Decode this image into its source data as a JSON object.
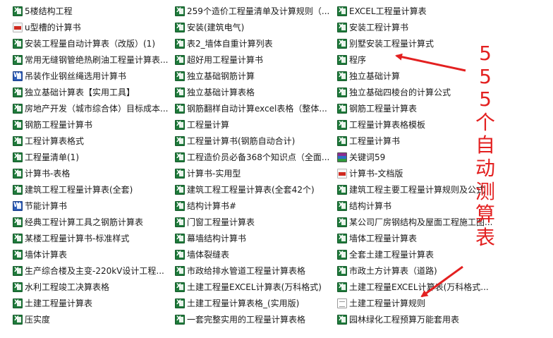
{
  "columns": [
    [
      {
        "type": "xls",
        "name": "5楼结构工程"
      },
      {
        "type": "pdf",
        "name": "u型槽的计算书"
      },
      {
        "type": "xls",
        "name": "安装工程量自动计算表（改版）(1)"
      },
      {
        "type": "xls",
        "name": "常用无缝钢管绝热刷油工程量计算表..."
      },
      {
        "type": "doc",
        "name": "吊装作业钢丝绳选用计算书"
      },
      {
        "type": "xls",
        "name": "独立基础计算表【实用工具】"
      },
      {
        "type": "xls",
        "name": "房地产开发（城市综合体）目标成本..."
      },
      {
        "type": "xls",
        "name": "钢筋工程量计算书"
      },
      {
        "type": "xls",
        "name": "工程计算表格式"
      },
      {
        "type": "xls",
        "name": "工程量清单(1)"
      },
      {
        "type": "xls",
        "name": "计算书-表格"
      },
      {
        "type": "xls",
        "name": "建筑工程工程量计算表(全套)"
      },
      {
        "type": "doc",
        "name": "节能计算书"
      },
      {
        "type": "xls",
        "name": "经典工程计算工具之钢筋计算表"
      },
      {
        "type": "xls",
        "name": "某楼工程量计算书-标准样式"
      },
      {
        "type": "xls",
        "name": "墙体计算表"
      },
      {
        "type": "xls",
        "name": "生产综合楼及主变-220kV设计工程..."
      },
      {
        "type": "xls",
        "name": "水利工程竣工决算表格"
      },
      {
        "type": "xls",
        "name": "土建工程量计算表"
      },
      {
        "type": "xls",
        "name": "压实度"
      }
    ],
    [
      {
        "type": "xls",
        "name": "259个造价工程量清单及计算规则（..."
      },
      {
        "type": "xls",
        "name": "安装(建筑电气)"
      },
      {
        "type": "xls",
        "name": "表2_墙体自重计算列表"
      },
      {
        "type": "xls",
        "name": "超好用工程量计算书"
      },
      {
        "type": "xls",
        "name": "独立基础钢筋计算"
      },
      {
        "type": "xls",
        "name": "独立基础计算表格"
      },
      {
        "type": "xls",
        "name": "钢筋翻样自动计算excel表格（整体..."
      },
      {
        "type": "xls",
        "name": "工程量计算"
      },
      {
        "type": "xls",
        "name": "工程量计算书(钢筋自动合计)"
      },
      {
        "type": "xls",
        "name": "工程造价员必备368个知识点（全面..."
      },
      {
        "type": "xls",
        "name": "计算书-实用型"
      },
      {
        "type": "xls",
        "name": "建筑工程工程量计算表(全套42个)"
      },
      {
        "type": "xls",
        "name": "结构计算书#"
      },
      {
        "type": "xls",
        "name": "门窗工程量计算表"
      },
      {
        "type": "xls",
        "name": "幕墙结构计算书"
      },
      {
        "type": "xls",
        "name": "墙体裂缝表"
      },
      {
        "type": "xls",
        "name": "市政给排水管道工程量计算表格"
      },
      {
        "type": "xls",
        "name": "土建工程量EXCEL计算表(万科格式)"
      },
      {
        "type": "xls",
        "name": "土建工程量计算表格_(实用版)"
      },
      {
        "type": "xls",
        "name": "一套完整实用的工程量计算表格"
      }
    ],
    [
      {
        "type": "xls",
        "name": "EXCEL工程量计算表"
      },
      {
        "type": "xls",
        "name": "安装工程计算书"
      },
      {
        "type": "xls",
        "name": "别墅安装工程量计算式"
      },
      {
        "type": "xls",
        "name": "程序"
      },
      {
        "type": "xls",
        "name": "独立基础计算"
      },
      {
        "type": "xls",
        "name": "独立基础四棱台的计算公式"
      },
      {
        "type": "xls",
        "name": "钢筋工程量计算表"
      },
      {
        "type": "xls",
        "name": "工程量计算表格模板"
      },
      {
        "type": "xls",
        "name": "工程量计算书"
      },
      {
        "type": "rar",
        "name": "关键词59"
      },
      {
        "type": "pdf",
        "name": "计算书-文档版"
      },
      {
        "type": "xls",
        "name": "建筑工程主要工程量计算规则及公式"
      },
      {
        "type": "xls",
        "name": "结构计算书"
      },
      {
        "type": "xls",
        "name": "某公司厂房钢结构及屋面工程施工图..."
      },
      {
        "type": "xls",
        "name": "墙体工程量计算表"
      },
      {
        "type": "xls",
        "name": "全套土建工程量计算表"
      },
      {
        "type": "xls",
        "name": "市政土方计算表（道路)"
      },
      {
        "type": "xls",
        "name": "土建工程量EXCEL计算表(万科格式..."
      },
      {
        "type": "txt",
        "name": "土建工程量计算规则"
      },
      {
        "type": "xls",
        "name": "园林绿化工程预算万能套用表"
      }
    ]
  ],
  "annotation": {
    "chars": [
      "5",
      "5",
      "5",
      "个",
      "自",
      "动",
      "测",
      "算",
      "表"
    ],
    "color": "#e32020"
  }
}
